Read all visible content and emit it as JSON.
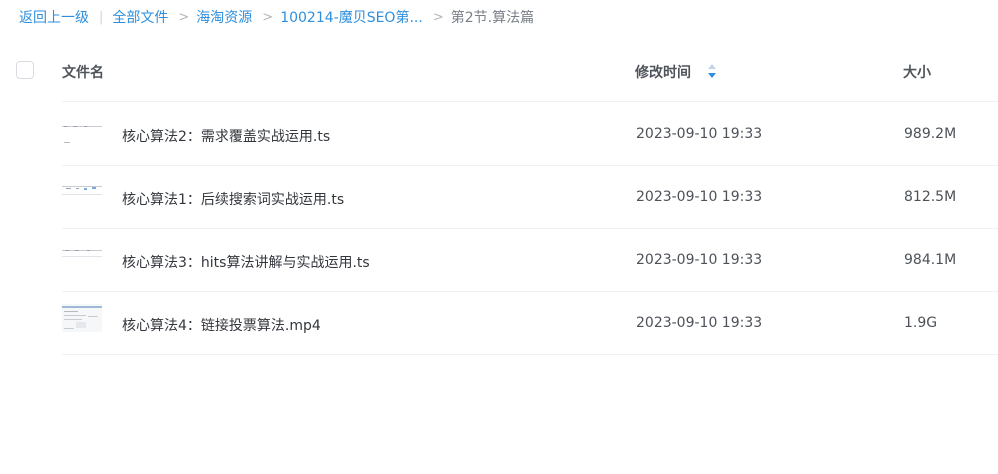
{
  "breadcrumb": {
    "back": "返回上一级",
    "divider": "|",
    "sep": ">",
    "items": [
      "全部文件",
      "海淘资源",
      "100214-魔贝SEO第...",
      "第2节.算法篇"
    ]
  },
  "table": {
    "headers": {
      "name": "文件名",
      "modified": "修改时间",
      "size": "大小"
    },
    "sort_icon": "sort-arrows-icon",
    "rows": [
      {
        "name": "核心算法2：需求覆盖实战运用.ts",
        "modified": "2023-09-10 19:33",
        "size": "989.2M",
        "thumb": "video-thumbnail-icon"
      },
      {
        "name": "核心算法1：后续搜索词实战运用.ts",
        "modified": "2023-09-10 19:33",
        "size": "812.5M",
        "thumb": "video-thumbnail-icon"
      },
      {
        "name": "核心算法3：hits算法讲解与实战运用.ts",
        "modified": "2023-09-10 19:33",
        "size": "984.1M",
        "thumb": "video-thumbnail-icon"
      },
      {
        "name": "核心算法4：链接投票算法.mp4",
        "modified": "2023-09-10 19:33",
        "size": "1.9G",
        "thumb": "video-thumbnail-icon"
      }
    ]
  },
  "colors": {
    "link": "#2f8fdc",
    "sort_active": "#2f8fdc",
    "sort_inactive": "#c5d6e8"
  }
}
